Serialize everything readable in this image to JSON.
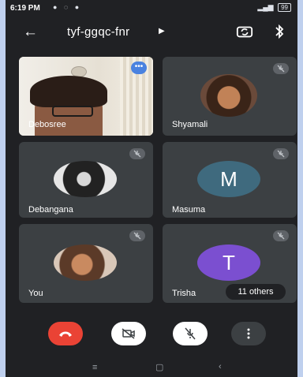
{
  "status_bar": {
    "time": "6:19 PM",
    "battery": "99"
  },
  "header": {
    "meeting_code": "tyf-ggqc-fnr"
  },
  "participants": [
    {
      "name": "Debosree",
      "type": "video"
    },
    {
      "name": "Shyamali",
      "type": "photo",
      "muted": true
    },
    {
      "name": "Debangana",
      "type": "photo",
      "muted": true
    },
    {
      "name": "Masuma",
      "type": "initial",
      "initial": "M",
      "color": "#3f6a7e",
      "muted": true
    },
    {
      "name": "You",
      "type": "photo",
      "muted": true
    },
    {
      "name": "Trisha",
      "type": "initial",
      "initial": "T",
      "color": "#7b4fd0",
      "muted": true
    }
  ],
  "others_label": "11 others",
  "colors": {
    "end_call": "#ea4335",
    "background": "#202124",
    "tile": "#3c4043"
  }
}
